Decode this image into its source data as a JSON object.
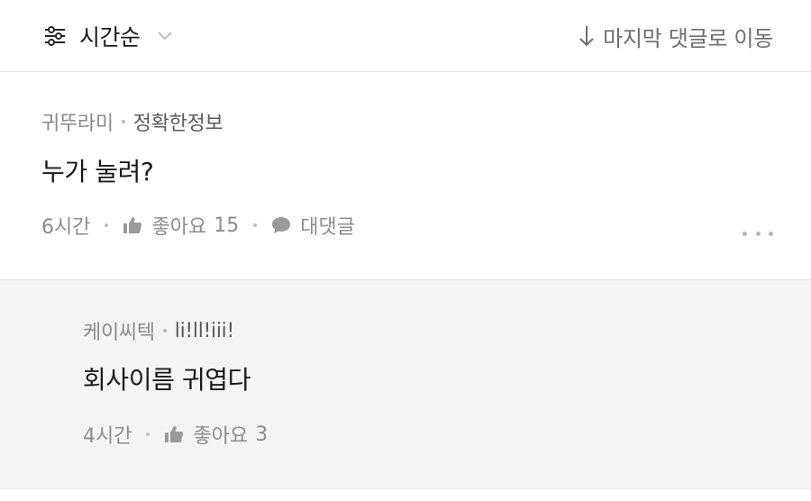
{
  "toolbar": {
    "sort_label": "시간순",
    "jump_label": "마지막 댓글로 이동"
  },
  "comments": [
    {
      "nickname": "귀뚜라미",
      "grade": "정확한정보",
      "text": "누가 눌려?",
      "time": "6시간",
      "like_label": "좋아요",
      "like_count": "15",
      "reply_label": "대댓글"
    }
  ],
  "replies": [
    {
      "nickname": "케이씨텍",
      "grade": "li!ll!iii!",
      "text": "회사이름 귀엽다",
      "time": "4시간",
      "like_label": "좋아요",
      "like_count": "3"
    }
  ],
  "colors": {
    "text_primary": "#1a1a1a",
    "text_secondary": "#8a8a8a",
    "reply_background": "#f4f4f4",
    "divider": "#e6e6e6"
  }
}
